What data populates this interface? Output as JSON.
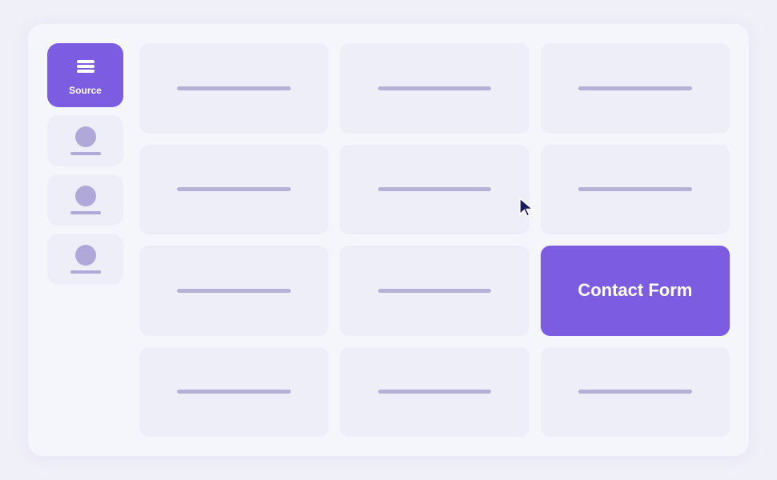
{
  "sidebar": {
    "items": [
      {
        "id": "source",
        "label": "Source",
        "type": "stack",
        "active": true
      },
      {
        "id": "item2",
        "label": "",
        "type": "avatar",
        "active": false
      },
      {
        "id": "item3",
        "label": "",
        "type": "avatar",
        "active": false
      },
      {
        "id": "item4",
        "label": "",
        "type": "avatar",
        "active": false
      }
    ]
  },
  "grid": {
    "rows": 4,
    "cols": 3,
    "contact_form_label": "Contact Form",
    "contact_form_position": {
      "row": 3,
      "col": 3
    }
  },
  "colors": {
    "accent": "#7c5ce0",
    "card_bg": "#eeeef8",
    "line": "#b5b0d5"
  }
}
